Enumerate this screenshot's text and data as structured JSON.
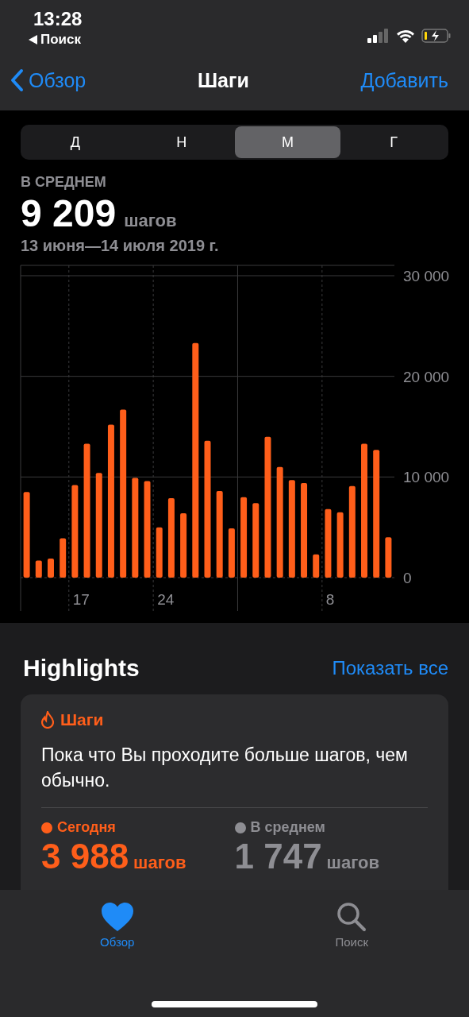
{
  "status_bar": {
    "time": "13:28",
    "back_app": "Поиск"
  },
  "nav": {
    "back": "Обзор",
    "title": "Шаги",
    "action": "Добавить"
  },
  "segments": [
    {
      "label": "Д",
      "selected": false
    },
    {
      "label": "Н",
      "selected": false
    },
    {
      "label": "М",
      "selected": true
    },
    {
      "label": "Г",
      "selected": false
    }
  ],
  "summary": {
    "label": "В СРЕДНЕМ",
    "value": "9 209",
    "unit": "шагов",
    "range": "13 июня—14 июля 2019 г."
  },
  "chart_data": {
    "type": "bar",
    "grid": true,
    "series": [
      {
        "color": "#ff5e1a",
        "values": [
          8500,
          1700,
          1900,
          3900,
          9200,
          13300,
          10400,
          15200,
          16700,
          9900,
          9600,
          5000,
          7900,
          6400,
          23300,
          13600,
          8600,
          4900,
          8000,
          7400,
          14000,
          11000,
          9700,
          9400,
          2300,
          6800,
          6500,
          9100,
          13300,
          12700,
          4000
        ]
      }
    ],
    "yticks": [
      {
        "value": 0,
        "label": "0"
      },
      {
        "value": 10000,
        "label": "10 000"
      },
      {
        "value": 20000,
        "label": "20 000"
      },
      {
        "value": 30000,
        "label": "30 000"
      }
    ],
    "ylim": [
      0,
      30000
    ]
  },
  "day_labels": [
    "17",
    "24",
    "8"
  ],
  "highlights": {
    "title": "Highlights",
    "link": "Показать все",
    "card": {
      "category": "Шаги",
      "text": "Пока что Вы проходите больше шагов, чем обычно.",
      "stats": [
        {
          "label": "Сегодня",
          "value": "3 988",
          "unit": "шагов",
          "color": "#ff5e1a"
        },
        {
          "label": "В среднем",
          "value": "1 747",
          "unit": "шагов",
          "color": "#8e8e93"
        }
      ]
    }
  },
  "tab_bar": [
    {
      "label": "Обзор",
      "kind": "heart",
      "selected": true
    },
    {
      "label": "Поиск",
      "kind": "search",
      "selected": false
    }
  ]
}
